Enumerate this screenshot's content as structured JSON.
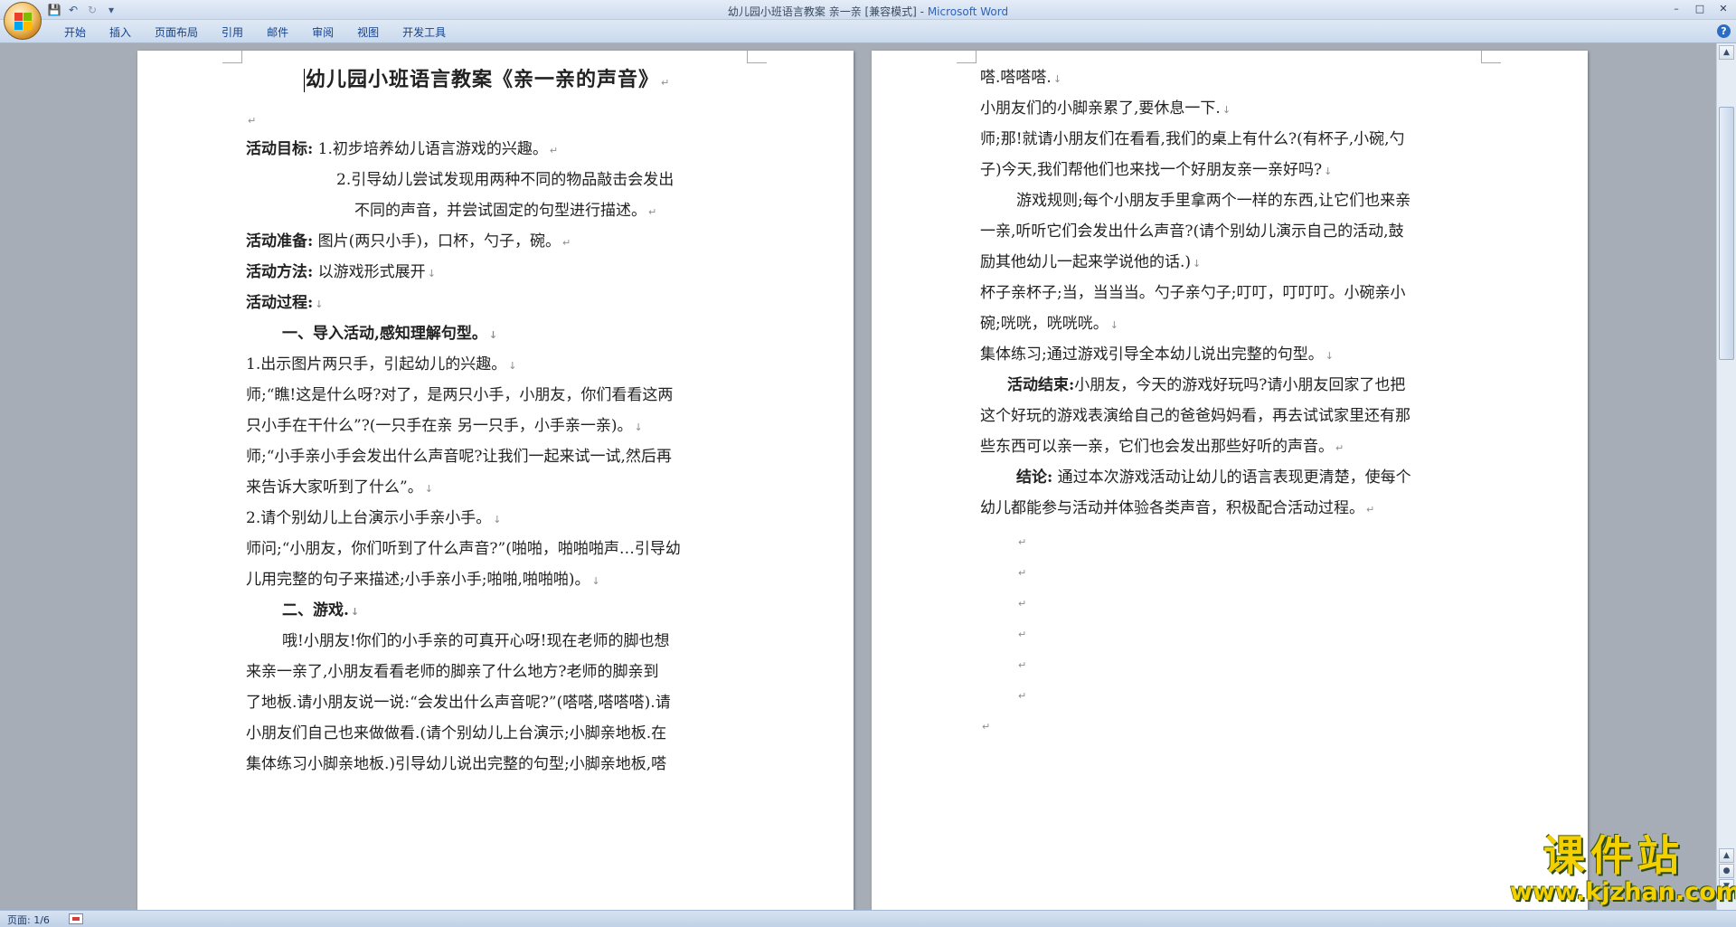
{
  "window": {
    "title": "幼儿园小班语言教案  亲一亲 [兼容模式] - ",
    "app_name": "Microsoft Word",
    "controls": [
      "–",
      "□",
      "✕"
    ]
  },
  "quick_access": {
    "save_icon": "💾",
    "undo_icon": "↶",
    "redo_icon": "↻",
    "customize_icon": "▾"
  },
  "ribbon": {
    "tabs": [
      "开始",
      "插入",
      "页面布局",
      "引用",
      "邮件",
      "审阅",
      "视图",
      "开发工具"
    ],
    "help_label": "?"
  },
  "page1": {
    "title": "幼儿园小班语言教案《亲一亲的声音》",
    "goal_label": "活动目标:",
    "goal_1": " 1.初步培养幼儿语言游戏的兴趣。",
    "goal_2a": "2.引导幼儿尝试发现用两种不同的物品敲击会发出",
    "goal_2b": "不同的声音，并尝试固定的句型进行描述。",
    "prep_label": "活动准备:",
    "prep_text": "  图片(两只小手)，口杯，勺子，碗。",
    "method_label": "活动方法:",
    "method_text": " 以游戏形式展开",
    "process_label": "活动过程:",
    "section1": "一、导入活动,感知理解句型。",
    "p1": "1.出示图片两只手，引起幼儿的兴趣。",
    "p2a": "师;“瞧!这是什么呀?对了，是两只小手，小朋友，你们看看这两",
    "p2b": "只小手在干什么”?(一只手在亲  另一只手，小手亲一亲)。",
    "p3a": "师;“小手亲小手会发出什么声音呢?让我们一起来试一试,然后再",
    "p3b": "来告诉大家听到了什么”。",
    "p4": "2.请个别幼儿上台演示小手亲小手。",
    "p5a": "师问;“小朋友，你们听到了什么声音?”(啪啪，啪啪啪声…引导幼",
    "p5b": "儿用完整的句子来描述;小手亲小手;啪啪,啪啪啪)。",
    "section2": "二、游戏.",
    "p6a": "哦!小朋友!你们的小手亲的可真开心呀!现在老师的脚也想",
    "p6b": "来亲一亲了,小朋友看看老师的脚亲了什么地方?老师的脚亲到",
    "p6c": "了地板.请小朋友说一说:“会发出什么声音呢?”(嗒嗒,嗒嗒嗒).请",
    "p6d": "小朋友们自己也来做做看.(请个别幼儿上台演示;小脚亲地板.在",
    "p6e": "集体练习小脚亲地板.)引导幼儿说出完整的句型;小脚亲地板,嗒"
  },
  "page2": {
    "l1": "嗒.嗒嗒嗒.",
    "l2": "小朋友们的小脚亲累了,要休息一下.",
    "l3": "师;那!就请小朋友们在看看,我们的桌上有什么?(有杯子,小碗,勺",
    "l4": "子)今天,我们帮他们也来找一个好朋友亲一亲好吗?",
    "l5": "游戏规则;每个小朋友手里拿两个一样的东西,让它们也来亲",
    "l6": "一亲,听听它们会发出什么声音?(请个别幼儿演示自己的活动,鼓",
    "l7": "励其他幼儿一起来学说他的话.)",
    "l8": "杯子亲杯子;当，当当当。勺子亲勺子;叮叮，叮叮叮。小碗亲小",
    "l9": "碗;咣咣，咣咣咣。",
    "l10": "集体练习;通过游戏引导全本幼儿说出完整的句型。",
    "end_label": "活动结束:",
    "end_a": "小朋友，今天的游戏好玩吗?请小朋友回家了也把",
    "end_b": "这个好玩的游戏表演给自己的爸爸妈妈看，再去试试家里还有那",
    "end_c": "些东西可以亲一亲，它们也会发出那些好听的声音。",
    "conc_label": "结论:",
    "conc_a": " 通过本次游戏活动让幼儿的语言表现更清楚，使每个",
    "conc_b": "幼儿都能参与活动并体验各类声音，积极配合活动过程。"
  },
  "marks": {
    "return": "↵",
    "newline": "↓"
  },
  "status": {
    "page": "页面: 1/6"
  },
  "watermark": {
    "title": "课件站",
    "url": "www.kjzhan.com"
  }
}
